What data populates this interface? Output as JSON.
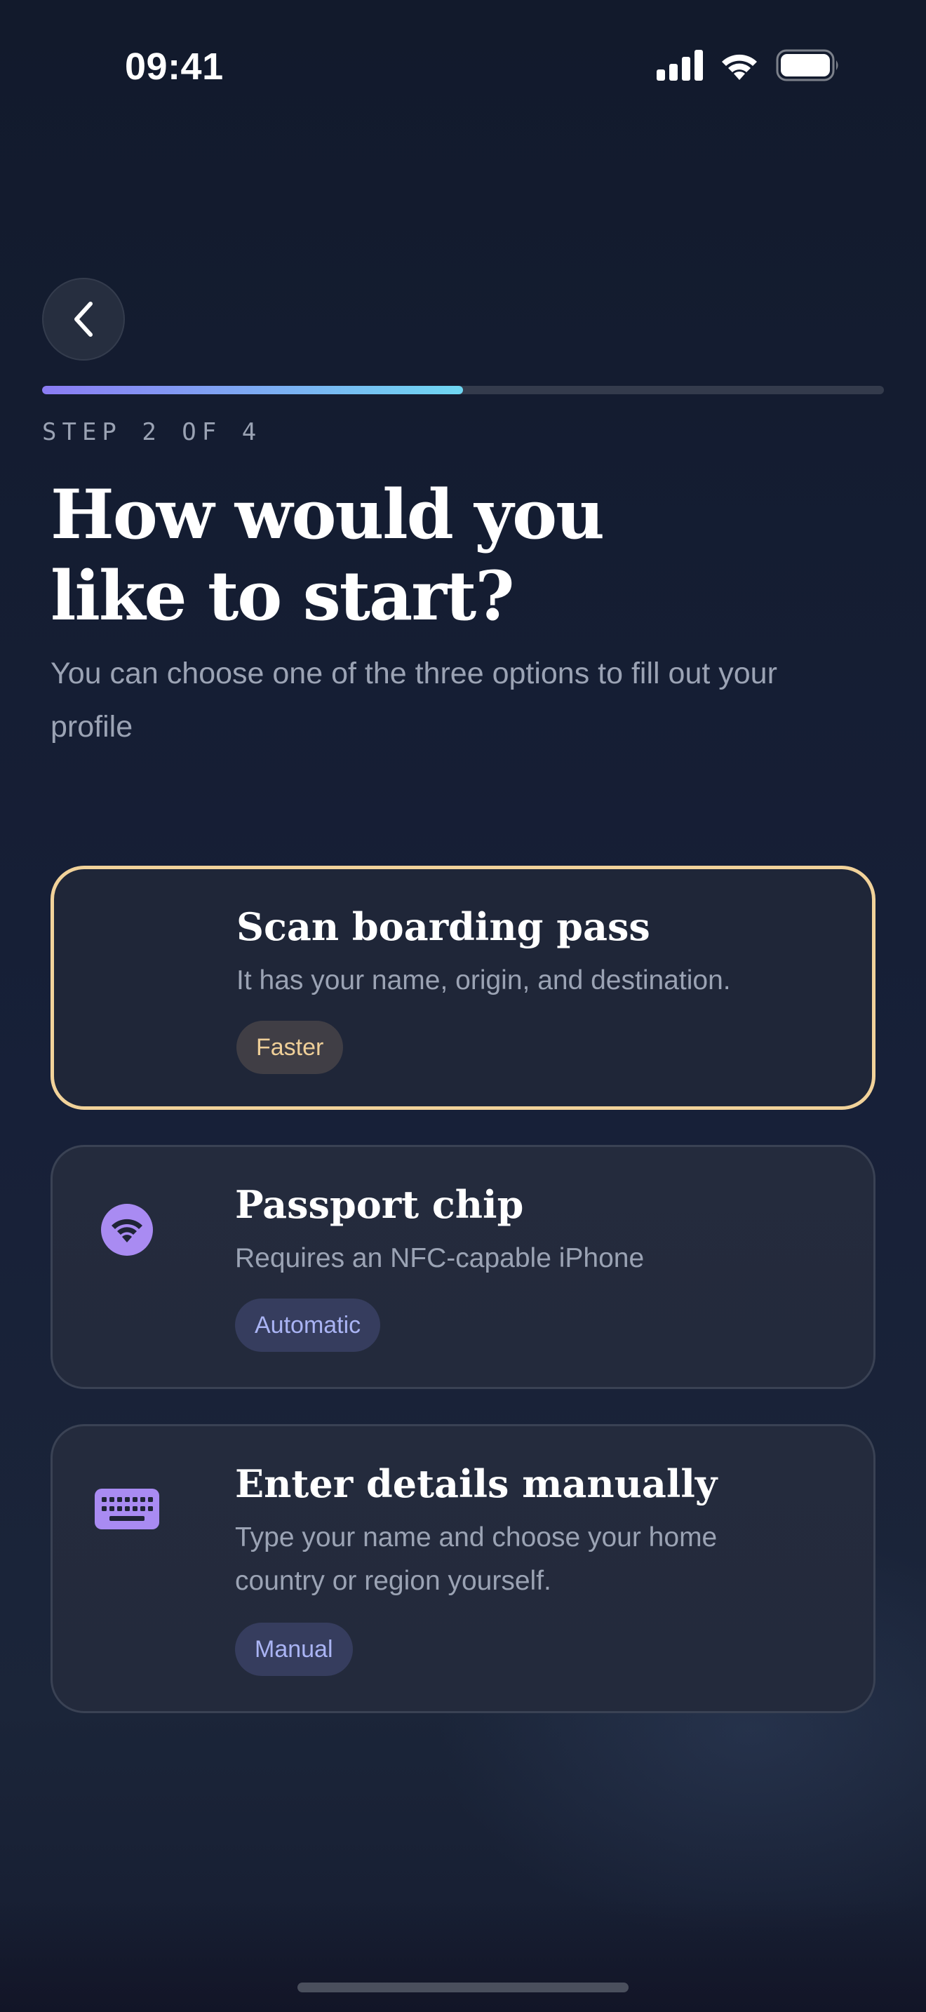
{
  "status_bar": {
    "time": "09:41"
  },
  "navigation": {
    "back_icon": "chevron-left-icon"
  },
  "progress": {
    "fraction": 0.5,
    "step_label": "STEP 2 OF 4",
    "gradient_start": "#8b7cf4",
    "gradient_end": "#6fd7f2"
  },
  "header": {
    "title": "How would you like to start?",
    "subtitle": "You can choose one of the three options to fill out your profile"
  },
  "options": [
    {
      "title": "Scan boarding pass",
      "description": "It has your name, origin, and destination.",
      "badge": "Faster",
      "selected": true,
      "accent": "#f1d29a"
    },
    {
      "title": "Passport chip",
      "description": "Requires an NFC-capable iPhone",
      "badge": "Automatic",
      "icon": "nfc-icon",
      "selected": false
    },
    {
      "title": "Enter details manually",
      "description": "Type your name and choose your home country or region yourself.",
      "badge": "Manual",
      "icon": "keyboard-icon",
      "selected": false
    }
  ],
  "colors": {
    "icon_purple": "#a98bf2",
    "background": "#141b2e"
  }
}
